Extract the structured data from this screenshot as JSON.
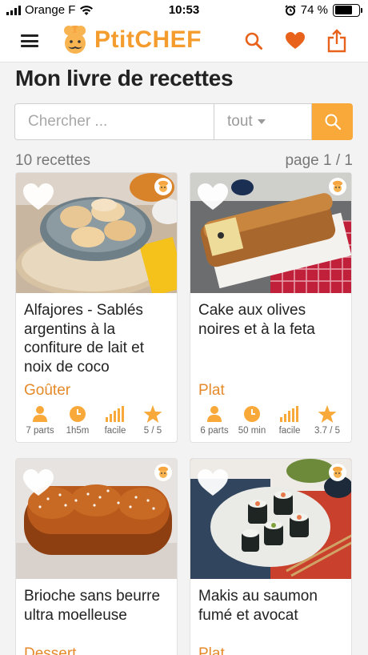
{
  "status_bar": {
    "carrier": "Orange F",
    "time": "10:53",
    "battery": "74 %",
    "battery_level": 0.74
  },
  "header": {
    "logo_text": "PtitCHEF"
  },
  "page": {
    "title": "Mon livre de recettes"
  },
  "search": {
    "placeholder": "Chercher ...",
    "filter_value": "tout"
  },
  "results": {
    "count": "10 recettes",
    "pagination": "page 1 / 1"
  },
  "recipes": [
    {
      "name": "Alfajores - Sablés argentins à la confiture de lait et noix de coco",
      "category": "Goûter",
      "servings": "7 parts",
      "time": "1h5m",
      "difficulty": "facile",
      "rating": "5 / 5"
    },
    {
      "name": "Cake aux olives noires et à la feta",
      "category": "Plat",
      "servings": "6 parts",
      "time": "50 min",
      "difficulty": "facile",
      "rating": "3.7 / 5"
    },
    {
      "name": "Brioche sans beurre ultra moelleuse",
      "category": "Dessert"
    },
    {
      "name": "Makis au saumon fumé et avocat",
      "category": "Plat"
    }
  ],
  "colors": {
    "accent": "#f8a93a",
    "brand": "#f59c2f",
    "category": "#e58a2a",
    "header_icons": "#e8621c"
  }
}
